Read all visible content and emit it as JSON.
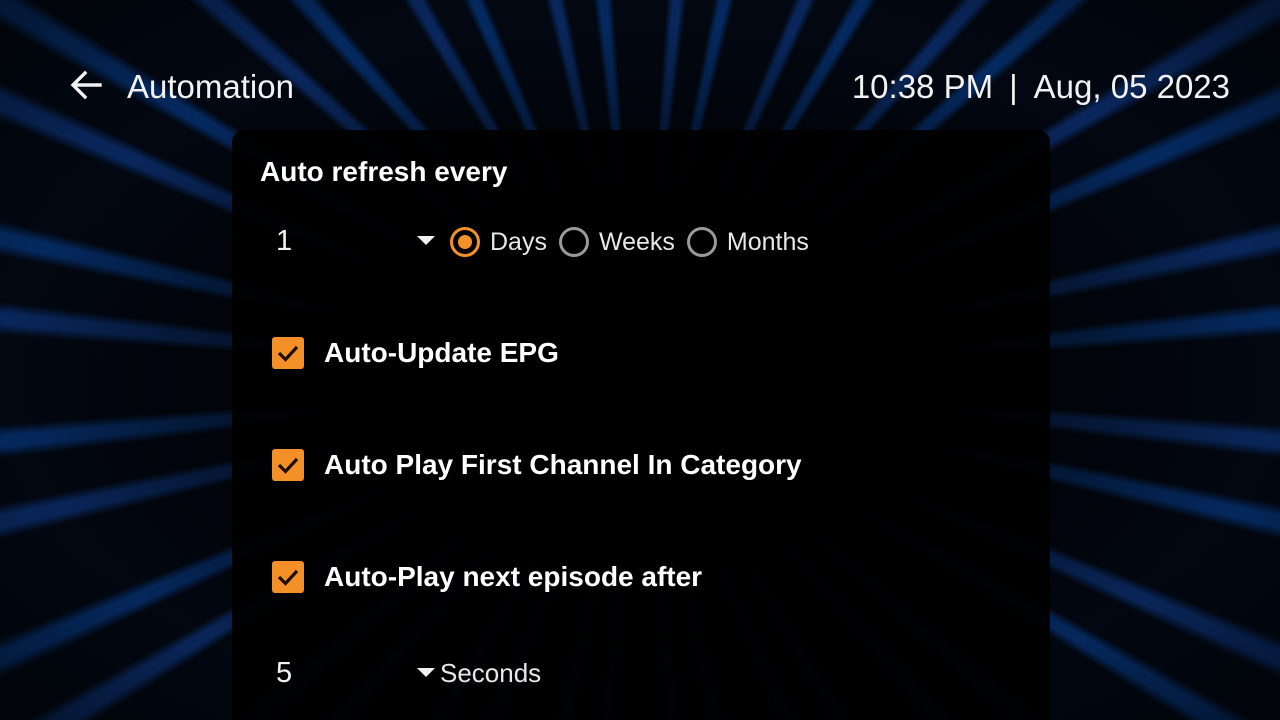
{
  "header": {
    "title": "Automation",
    "time": "10:38 PM",
    "separator": "|",
    "date": "Aug, 05 2023"
  },
  "auto_refresh": {
    "title": "Auto refresh every",
    "interval_value": "1",
    "units": [
      {
        "label": "Days",
        "selected": true
      },
      {
        "label": "Weeks",
        "selected": false
      },
      {
        "label": "Months",
        "selected": false
      }
    ]
  },
  "options": [
    {
      "label": "Auto-Update EPG",
      "checked": true
    },
    {
      "label": "Auto Play First Channel In Category",
      "checked": true
    },
    {
      "label": "Auto-Play next episode after",
      "checked": true
    }
  ],
  "next_episode": {
    "delay_value": "5",
    "unit_label": "Seconds"
  },
  "colors": {
    "accent": "#f39128",
    "panel_bg": "#000000",
    "text": "#ffffff",
    "background_rays": "#0b2d6b"
  },
  "icons": {
    "back": "arrow-left-icon",
    "dropdown": "caret-down-icon",
    "check": "checkmark-icon"
  }
}
